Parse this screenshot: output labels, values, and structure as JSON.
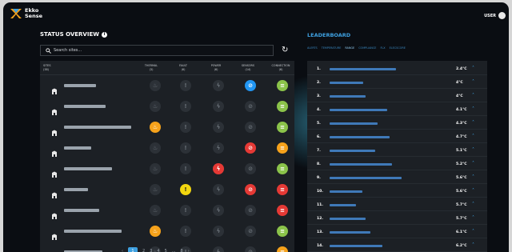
{
  "brand": {
    "line1": "Ekko",
    "line2": "Sense"
  },
  "user": {
    "label": "USER"
  },
  "status": {
    "title": "STATUS OVERVIEW",
    "search_placeholder": "Search sites...",
    "columns": [
      {
        "name": "SITES",
        "count": "(38)"
      },
      {
        "name": "THERMAL",
        "count": "(3)"
      },
      {
        "name": "FAULT",
        "count": "(6)"
      },
      {
        "name": "POWER",
        "count": "(6)"
      },
      {
        "name": "SENSORS",
        "count": "(14)"
      },
      {
        "name": "CONNECTION",
        "count": "(6)"
      }
    ],
    "rows": [
      {
        "name_fraction": 0.2,
        "thermal": "off",
        "fault": "off",
        "power": "off",
        "sensors": "blue",
        "connection": "green"
      },
      {
        "name_fraction": 0.26,
        "thermal": "off",
        "fault": "off",
        "power": "off",
        "sensors": "off",
        "connection": "green"
      },
      {
        "name_fraction": 0.42,
        "thermal": "orange",
        "fault": "off",
        "power": "off",
        "sensors": "off",
        "connection": "green"
      },
      {
        "name_fraction": 0.17,
        "thermal": "off",
        "fault": "off",
        "power": "off",
        "sensors": "red",
        "connection": "orange"
      },
      {
        "name_fraction": 0.3,
        "thermal": "off",
        "fault": "off",
        "power": "red",
        "sensors": "off",
        "connection": "green"
      },
      {
        "name_fraction": 0.15,
        "thermal": "off",
        "fault": "yellow",
        "power": "off",
        "sensors": "red",
        "connection": "red"
      },
      {
        "name_fraction": 0.22,
        "thermal": "off",
        "fault": "off",
        "power": "off",
        "sensors": "off",
        "connection": "red"
      },
      {
        "name_fraction": 0.36,
        "thermal": "orange",
        "fault": "off",
        "power": "off",
        "sensors": "off",
        "connection": "green"
      },
      {
        "name_fraction": 0.24,
        "thermal": "off",
        "fault": "off",
        "power": "off",
        "sensors": "off",
        "connection": "orange"
      }
    ],
    "pages": [
      "1",
      "2",
      "3",
      "4",
      "5",
      "...",
      "8"
    ]
  },
  "leaderboard": {
    "title": "LEADERBOARD",
    "tabs": [
      "ALERTS",
      "TEMPERATURE",
      "RANGE",
      "COMPLIANCE",
      "FLX",
      "ELECSCORE"
    ],
    "active_tab": 2,
    "rows": [
      {
        "rank": "1.",
        "value": "2.4°C",
        "name_fraction": 0.55
      },
      {
        "rank": "2.",
        "value": "4°C",
        "name_fraction": 0.28
      },
      {
        "rank": "3.",
        "value": "4°C",
        "name_fraction": 0.3
      },
      {
        "rank": "4.",
        "value": "4.1°C",
        "name_fraction": 0.48
      },
      {
        "rank": "5.",
        "value": "4.3°C",
        "name_fraction": 0.4
      },
      {
        "rank": "6.",
        "value": "4.7°C",
        "name_fraction": 0.5
      },
      {
        "rank": "7.",
        "value": "5.1°C",
        "name_fraction": 0.38
      },
      {
        "rank": "8.",
        "value": "5.2°C",
        "name_fraction": 0.52
      },
      {
        "rank": "9.",
        "value": "5.6°C",
        "name_fraction": 0.6
      },
      {
        "rank": "10.",
        "value": "5.6°C",
        "name_fraction": 0.27
      },
      {
        "rank": "11.",
        "value": "5.7°C",
        "name_fraction": 0.22
      },
      {
        "rank": "12.",
        "value": "5.7°C",
        "name_fraction": 0.3
      },
      {
        "rank": "13.",
        "value": "6.1°C",
        "name_fraction": 0.34
      },
      {
        "rank": "14.",
        "value": "6.2°C",
        "name_fraction": 0.44
      }
    ]
  },
  "colors": {
    "green": "#8bc34a",
    "orange": "#f6a21b",
    "red": "#e53935",
    "blue": "#2196f3",
    "yellow": "#f2d60f",
    "accent": "#3ea0e0"
  }
}
